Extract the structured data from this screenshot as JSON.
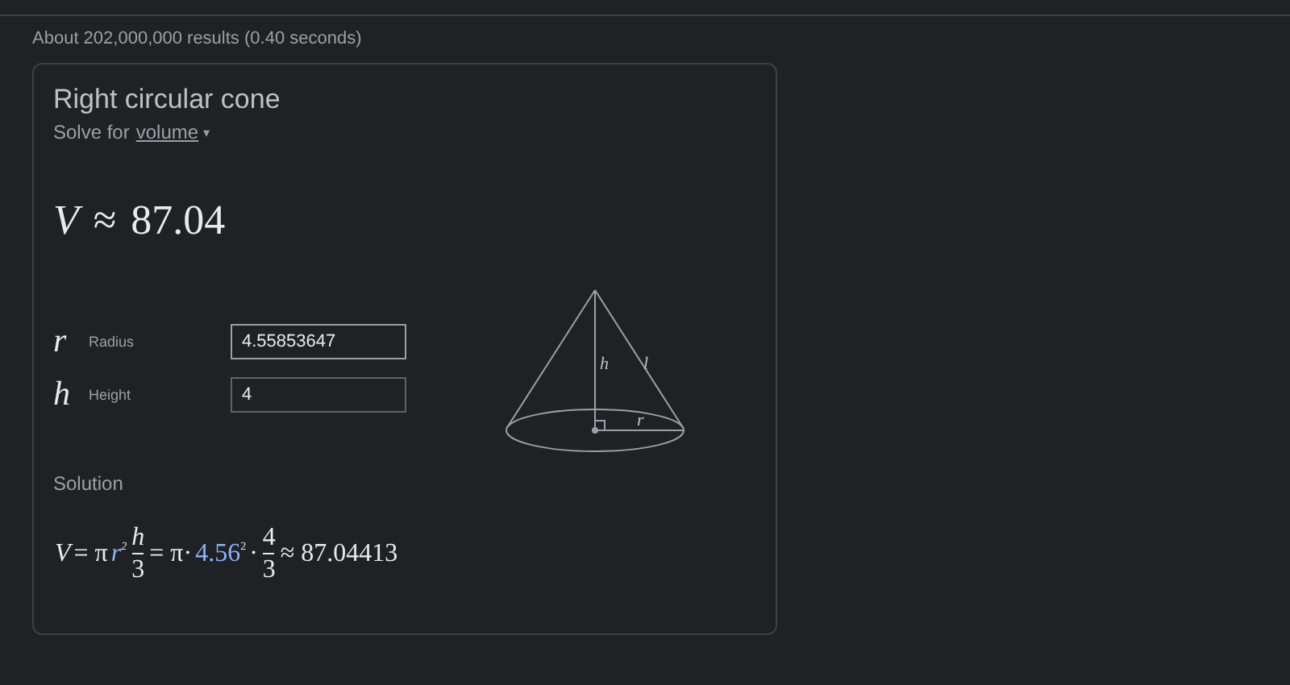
{
  "result_stats": "About 202,000,000 results (0.40 seconds)",
  "card": {
    "title": "Right circular cone",
    "solve_prefix": "Solve for",
    "solve_target": "volume",
    "caret": "▾",
    "answer": {
      "symbol": "V",
      "relation": "≈",
      "value": "87.04"
    },
    "inputs": [
      {
        "symbol": "r",
        "label": "Radius",
        "value": "4.55853647",
        "selected": true
      },
      {
        "symbol": "h",
        "label": "Height",
        "value": "4",
        "selected": false
      }
    ],
    "diagram": {
      "labels": [
        "h",
        "l",
        "r"
      ]
    },
    "solution_label": "Solution",
    "solution": [
      {
        "kind": "text",
        "text": "V",
        "italic": true,
        "highlighted": false
      },
      {
        "kind": "text",
        "text": "= π",
        "italic": false,
        "highlighted": false
      },
      {
        "kind": "sup",
        "text": "r",
        "exp": "2",
        "italic": true,
        "highlighted": true
      },
      {
        "kind": "frac",
        "num": "h",
        "den": "3",
        "italic": true
      },
      {
        "kind": "text",
        "text": "= π·",
        "italic": false,
        "highlighted": false
      },
      {
        "kind": "sup",
        "text": "4.56",
        "exp": "2",
        "italic": false,
        "highlighted": true
      },
      {
        "kind": "text",
        "text": "·",
        "italic": false,
        "highlighted": false
      },
      {
        "kind": "frac",
        "num": "4",
        "den": "3",
        "italic": false
      },
      {
        "kind": "text",
        "text": "≈ 87.04413",
        "italic": false,
        "highlighted": false
      }
    ]
  }
}
